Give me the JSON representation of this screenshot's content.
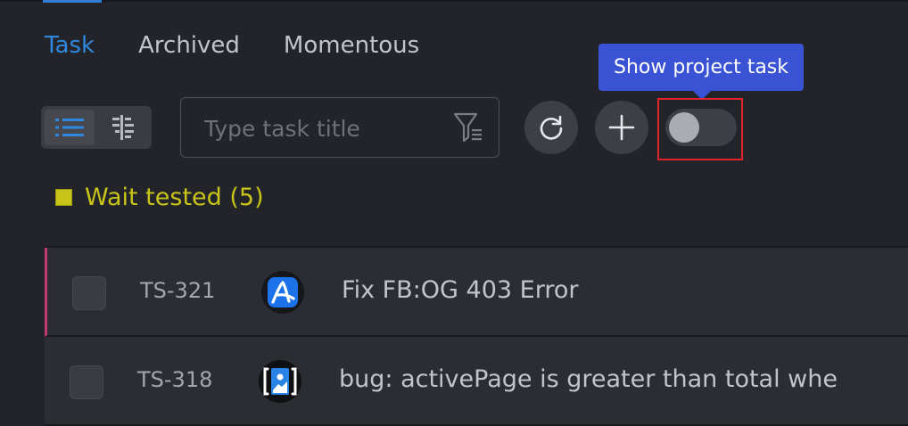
{
  "tabs": [
    {
      "label": "Task",
      "active": true
    },
    {
      "label": "Archived",
      "active": false
    },
    {
      "label": "Momentous",
      "active": false
    }
  ],
  "toolbar": {
    "view_modes": [
      "list-icon",
      "kanban-icon"
    ],
    "search_placeholder": "Type task title",
    "search_value": "",
    "refresh_icon": "refresh-icon",
    "add_icon": "plus-icon",
    "show_project_task_enabled": false,
    "tooltip": "Show project task"
  },
  "group": {
    "label": "Wait tested (5)",
    "color": "#c8c41a"
  },
  "tasks": [
    {
      "id": "TS-321",
      "title": "Fix FB:OG 403 Error",
      "avatar_icon": "app-logo-icon"
    },
    {
      "id": "TS-318",
      "title": "bug: activePage is greater than total whe",
      "avatar_icon": "image-icon"
    }
  ],
  "colors": {
    "accent": "#2f87de",
    "background": "#222429",
    "tooltip": "#3953d4",
    "highlight": "#e0242b",
    "flag": "#c03a73"
  }
}
